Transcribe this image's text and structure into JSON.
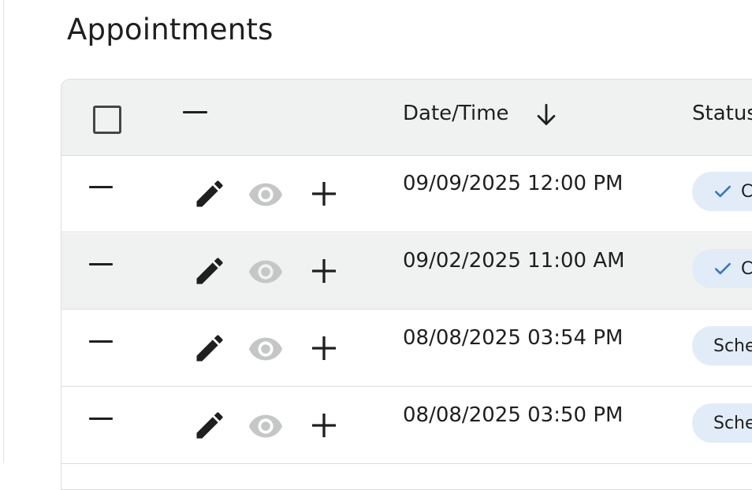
{
  "page": {
    "title": "Appointments"
  },
  "table": {
    "header": {
      "datetime_label": "Date/Time",
      "status_label": "Status"
    },
    "rows": [
      {
        "datetime": "09/09/2025 12:00 PM",
        "status": "C",
        "status_check": true,
        "highlight": false
      },
      {
        "datetime": "09/02/2025 11:00 AM",
        "status": "C",
        "status_check": true,
        "highlight": true
      },
      {
        "datetime": "08/08/2025 03:54 PM",
        "status": "Sche",
        "status_check": false,
        "highlight": false
      },
      {
        "datetime": "08/08/2025 03:50 PM",
        "status": "Sche",
        "status_check": false,
        "highlight": false
      }
    ]
  },
  "colors": {
    "header_bg": "#f0f2f1",
    "badge_bg": "#e1ecf8",
    "check": "#3b78c2",
    "view_icon_disabled": "#c4c7c5"
  },
  "icons": {
    "sort": "arrow-down-icon",
    "edit": "pencil-icon",
    "view": "eye-icon",
    "add": "plus-icon",
    "check": "check-icon"
  }
}
